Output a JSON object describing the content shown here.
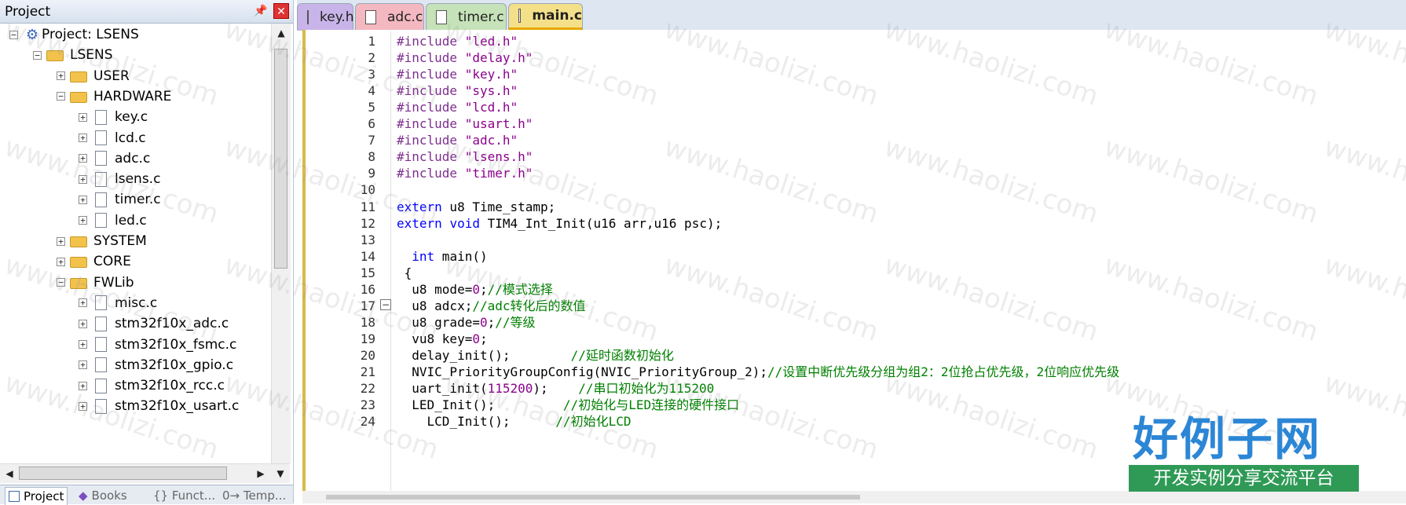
{
  "project_panel": {
    "title": "Project",
    "pin_icon": "pin-icon",
    "close_icon": "close-icon",
    "tree": [
      {
        "label": "Project: LSENS",
        "type": "project",
        "expand": "−"
      },
      {
        "label": "LSENS",
        "type": "folder",
        "expand": "−"
      },
      {
        "label": "USER",
        "type": "folder",
        "expand": "+"
      },
      {
        "label": "HARDWARE",
        "type": "folder",
        "expand": "−"
      },
      {
        "label": "key.c",
        "type": "file",
        "expand": "+"
      },
      {
        "label": "lcd.c",
        "type": "file",
        "expand": "+"
      },
      {
        "label": "adc.c",
        "type": "file",
        "expand": "+"
      },
      {
        "label": "lsens.c",
        "type": "file",
        "expand": "+"
      },
      {
        "label": "timer.c",
        "type": "file",
        "expand": "+"
      },
      {
        "label": "led.c",
        "type": "file",
        "expand": "+"
      },
      {
        "label": "SYSTEM",
        "type": "folder",
        "expand": "+"
      },
      {
        "label": "CORE",
        "type": "folder",
        "expand": "+"
      },
      {
        "label": "FWLib",
        "type": "folder",
        "expand": "−"
      },
      {
        "label": "misc.c",
        "type": "file",
        "expand": "+"
      },
      {
        "label": "stm32f10x_adc.c",
        "type": "file",
        "expand": "+"
      },
      {
        "label": "stm32f10x_fsmc.c",
        "type": "file",
        "expand": "+"
      },
      {
        "label": "stm32f10x_gpio.c",
        "type": "file",
        "expand": "+"
      },
      {
        "label": "stm32f10x_rcc.c",
        "type": "file",
        "expand": "+"
      },
      {
        "label": "stm32f10x_usart.c",
        "type": "file",
        "expand": "+"
      }
    ],
    "bottom_tabs": [
      "Project",
      "Books",
      "{} Funct...",
      "0→ Temp..."
    ]
  },
  "editor": {
    "tabs": [
      {
        "label": "key.h",
        "color": "#c8b4e8"
      },
      {
        "label": "adc.c",
        "color": "#f4b8c0"
      },
      {
        "label": "timer.c",
        "color": "#c6e2b8"
      },
      {
        "label": "main.c",
        "color": "#f5e08a",
        "active": true
      }
    ],
    "lines": [
      {
        "n": "1",
        "parts": [
          [
            "pp",
            "#include "
          ],
          [
            "str",
            "\"led.h\""
          ]
        ]
      },
      {
        "n": "2",
        "parts": [
          [
            "pp",
            "#include "
          ],
          [
            "str",
            "\"delay.h\""
          ]
        ]
      },
      {
        "n": "3",
        "parts": [
          [
            "pp",
            "#include "
          ],
          [
            "str",
            "\"key.h\""
          ]
        ]
      },
      {
        "n": "4",
        "parts": [
          [
            "pp",
            "#include "
          ],
          [
            "str",
            "\"sys.h\""
          ]
        ]
      },
      {
        "n": "5",
        "parts": [
          [
            "pp",
            "#include "
          ],
          [
            "str",
            "\"lcd.h\""
          ]
        ]
      },
      {
        "n": "6",
        "parts": [
          [
            "pp",
            "#include "
          ],
          [
            "str",
            "\"usart.h\""
          ]
        ]
      },
      {
        "n": "7",
        "parts": [
          [
            "pp",
            "#include "
          ],
          [
            "str",
            "\"adc.h\""
          ]
        ]
      },
      {
        "n": "8",
        "parts": [
          [
            "pp",
            "#include "
          ],
          [
            "str",
            "\"lsens.h\""
          ]
        ]
      },
      {
        "n": "9",
        "parts": [
          [
            "pp",
            "#include "
          ],
          [
            "str",
            "\"timer.h\""
          ]
        ]
      },
      {
        "n": "10",
        "parts": []
      },
      {
        "n": "11",
        "parts": [
          [
            "kw",
            "extern"
          ],
          [
            "t",
            " u8 Time_stamp;"
          ]
        ]
      },
      {
        "n": "12",
        "parts": [
          [
            "kw",
            "extern"
          ],
          [
            "t",
            " "
          ],
          [
            "kw",
            "void"
          ],
          [
            "t",
            " TIM4_Int_Init(u16 arr,u16 psc);"
          ]
        ]
      },
      {
        "n": "13",
        "parts": []
      },
      {
        "n": "14",
        "parts": [
          [
            "t",
            "  "
          ],
          [
            "kw",
            "int"
          ],
          [
            "t",
            " main()"
          ]
        ]
      },
      {
        "n": "15",
        "parts": [
          [
            "t",
            " {"
          ]
        ]
      },
      {
        "n": "16",
        "parts": [
          [
            "t",
            "  u8 mode="
          ],
          [
            "num",
            "0"
          ],
          [
            "t",
            ";"
          ],
          [
            "cm",
            "//模式选择"
          ]
        ]
      },
      {
        "n": "17",
        "parts": [
          [
            "t",
            "  u8 adcx;"
          ],
          [
            "cm",
            "//adc转化后的数值"
          ]
        ]
      },
      {
        "n": "18",
        "parts": [
          [
            "t",
            "  u8 grade="
          ],
          [
            "num",
            "0"
          ],
          [
            "t",
            ";"
          ],
          [
            "cm",
            "//等级"
          ]
        ]
      },
      {
        "n": "19",
        "parts": [
          [
            "t",
            "  vu8 key="
          ],
          [
            "num",
            "0"
          ],
          [
            "t",
            ";"
          ]
        ]
      },
      {
        "n": "20",
        "parts": [
          [
            "t",
            "  delay_init();        "
          ],
          [
            "cm",
            "//延时函数初始化"
          ]
        ]
      },
      {
        "n": "21",
        "parts": [
          [
            "t",
            "  NVIC_PriorityGroupConfig(NVIC_PriorityGroup_2);"
          ],
          [
            "cm",
            "//设置中断优先级分组为组2：2位抢占优先级，2位响应优先级"
          ]
        ]
      },
      {
        "n": "22",
        "parts": [
          [
            "t",
            "  uart_init("
          ],
          [
            "num",
            "115200"
          ],
          [
            "t",
            ");    "
          ],
          [
            "cm",
            "//串口初始化为115200"
          ]
        ]
      },
      {
        "n": "23",
        "parts": [
          [
            "t",
            "  LED_Init();         "
          ],
          [
            "cm",
            "//初始化与LED连接的硬件接口"
          ]
        ]
      },
      {
        "n": "24",
        "parts": [
          [
            "t",
            "    LCD_Init();      "
          ],
          [
            "cm",
            "//初始化LCD"
          ]
        ]
      }
    ],
    "fold_icon": "collapse-minus-icon"
  },
  "watermark": "www.haolizi.com",
  "logo": {
    "main": "好例子网",
    "sub": "开发实例分享交流平台"
  }
}
